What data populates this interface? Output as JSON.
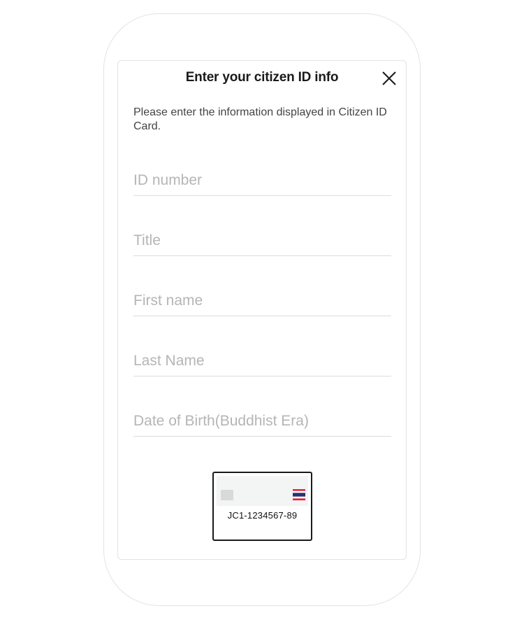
{
  "dialog": {
    "title": "Enter your citizen ID info",
    "instructions": "Please enter the information displayed in Citizen ID Card.",
    "close_icon": "close-icon"
  },
  "form": {
    "fields": [
      {
        "name": "id-number-field",
        "placeholder": "ID number",
        "value": ""
      },
      {
        "name": "title-field",
        "placeholder": "Title",
        "value": ""
      },
      {
        "name": "first-name-field",
        "placeholder": "First name",
        "value": ""
      },
      {
        "name": "last-name-field",
        "placeholder": "Last Name",
        "value": ""
      },
      {
        "name": "date-of-birth-field",
        "placeholder": "Date of Birth(Buddhist Era)",
        "value": ""
      }
    ]
  },
  "card_illustration": {
    "number": "JC1-1234567-89",
    "flag_icon": "thai-flag-icon",
    "chip_icon": "card-chip-icon",
    "colors": {
      "flag_red": "#e4233b",
      "flag_white": "#ffffff",
      "flag_blue": "#27336f"
    }
  }
}
